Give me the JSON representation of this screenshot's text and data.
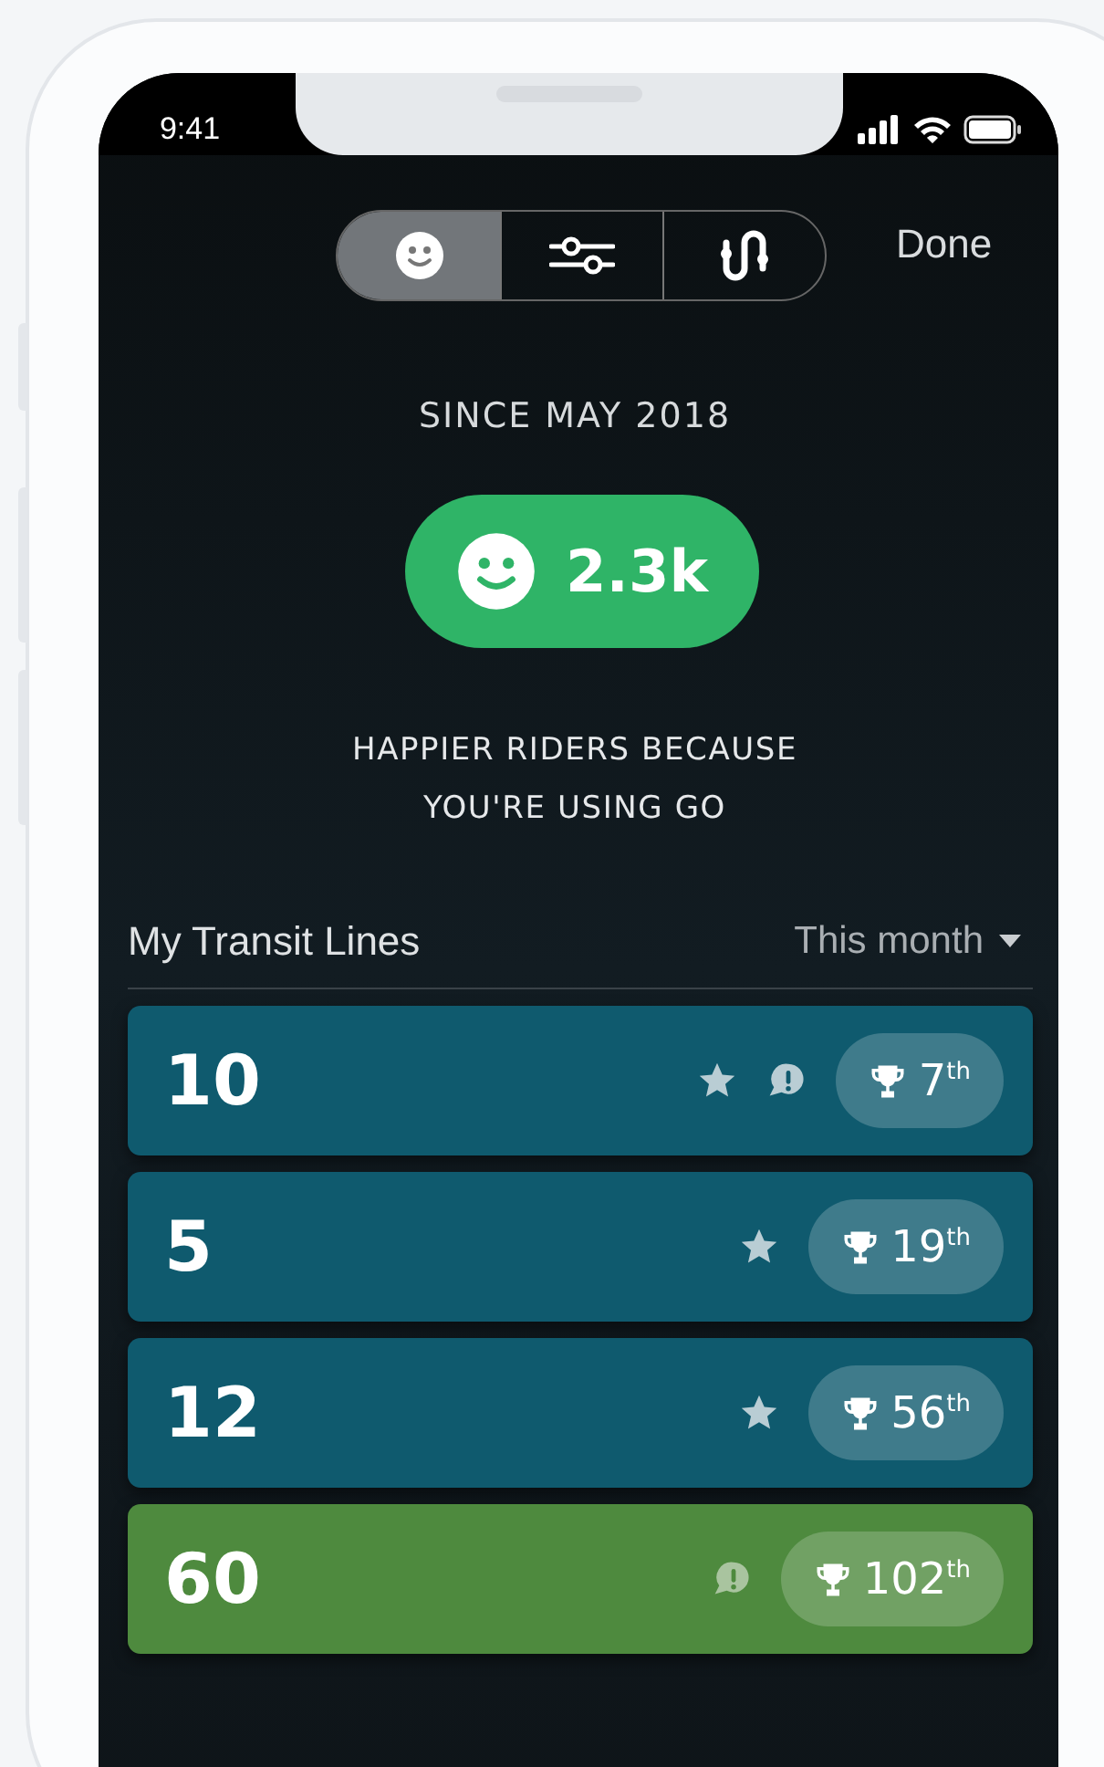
{
  "status_bar": {
    "time": "9:41"
  },
  "segments": [
    {
      "kind": "smiley",
      "selected": true
    },
    {
      "kind": "sliders",
      "selected": false
    },
    {
      "kind": "route",
      "selected": false
    }
  ],
  "done": "Done",
  "since": "SINCE MAY 2018",
  "happy_count": "2.3k",
  "caption_lines": [
    "HAPPIER RIDERS BECAUSE",
    "YOU'RE USING GO"
  ],
  "section": {
    "title": "My Transit Lines",
    "period": "This month"
  },
  "lines": [
    {
      "number": "10",
      "color": "#0f5a6e",
      "starred": true,
      "alert": true,
      "rank": "7$^{th}$"
    },
    {
      "number": "5",
      "color": "#0f5a6e",
      "starred": true,
      "alert": false,
      "rank": "19$^{th}$"
    },
    {
      "number": "12",
      "color": "#0f5a6e",
      "starred": true,
      "alert": false,
      "rank": "56$^{th}$"
    },
    {
      "number": "60",
      "color": "#4e8a3e",
      "starred": false,
      "alert": true,
      "rank": "102$^{th}$"
    }
  ]
}
